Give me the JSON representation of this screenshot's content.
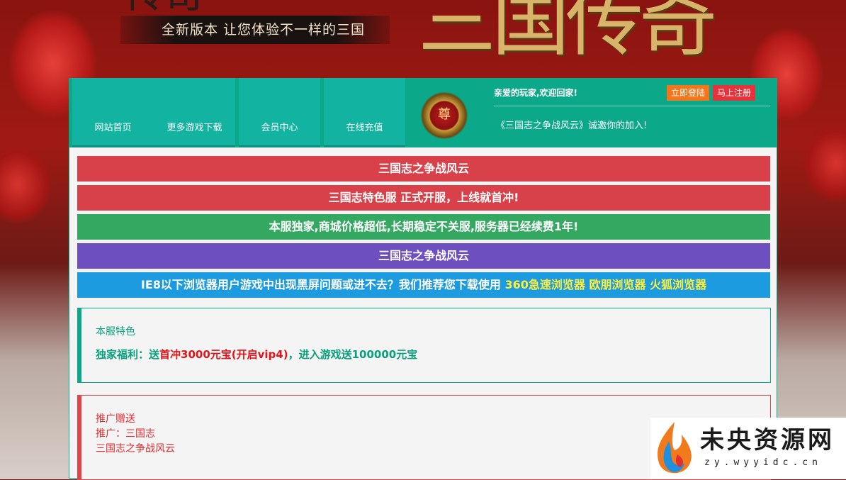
{
  "banner": {
    "slogan": "全新版本 让您体验不一样的三国",
    "title_art": "三国传奇",
    "left_art": "传奇"
  },
  "nav": {
    "items": [
      {
        "label": "网站首页"
      },
      {
        "label": "更多游戏下载"
      },
      {
        "label": "会员中心"
      },
      {
        "label": "在线充值"
      }
    ]
  },
  "user": {
    "avatar_char": "尊",
    "welcome": "亲爱的玩家,欢迎回家!",
    "login_label": "立即登陆",
    "register_label": "马上注册",
    "invite": "《三国志之争战风云》诚邀你的加入!"
  },
  "announcements": [
    {
      "text": "三国志之争战风云",
      "color": "#d9414a"
    },
    {
      "text": "三国志特色服 正式开服，上线就首冲!",
      "color": "#d9414a"
    },
    {
      "text": "本服独家,商城价格超低,长期稳定不关服,服务器已经续费1年!",
      "color": "#34a861"
    },
    {
      "text": "三国志之争战风云",
      "color": "#6d4fc0"
    }
  ],
  "browser_notice": {
    "text": "IE8以下浏览器用户游戏中出现黑屏问题或进不去？我们推荐您下载使用",
    "links": [
      "360急速浏览器",
      "欧朋浏览器",
      "火狐浏览器"
    ],
    "color": "#1d9be0",
    "link_color": "#ffef3a"
  },
  "feature_box": {
    "title": "本服特色",
    "line_prefix": "独家福利：送",
    "line_highlight": "首冲3000元宝(开启vip4)",
    "line_suffix": "，进入游戏送100000元宝",
    "accent": "#0aa888"
  },
  "promo_box": {
    "title": "推广赠送",
    "line1": "推广：三国志",
    "line2": "三国志之争战风云",
    "accent": "#e24346"
  },
  "watermark": {
    "title": "未央资源网",
    "url": "zy.wyyidc.cn"
  }
}
